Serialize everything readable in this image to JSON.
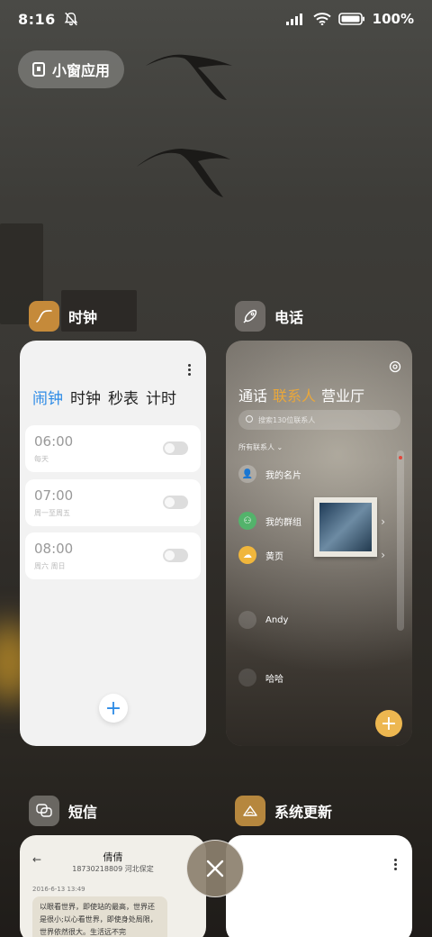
{
  "status_bar": {
    "time": "8:16",
    "battery": "100%"
  },
  "small_window": {
    "label": "小窗应用"
  },
  "apps": {
    "clock": {
      "name": "时钟",
      "icon_color": "#c58a3a",
      "tabs": [
        "闹钟",
        "计时",
        "秒表",
        "计时"
      ],
      "tab_labels": {
        "alarm": "闹钟",
        "clock": "时钟",
        "stopwatch": "秒表",
        "timer": "计时"
      },
      "active_tab": "闹钟",
      "accent": "#2d8be6",
      "alarms": [
        {
          "time": "06:00",
          "repeat": "每天"
        },
        {
          "time": "07:00",
          "repeat": "周一至周五"
        },
        {
          "time": "08:00",
          "repeat": "周六 周日"
        }
      ]
    },
    "phone": {
      "name": "电话",
      "tabs": {
        "calls": "通话",
        "contacts": "联系人",
        "hall": "营业厅"
      },
      "active_tab": "联系人",
      "accent": "#e9a73b",
      "search_placeholder": "搜索130位联系人",
      "section_label": "所有联系人",
      "contacts": [
        {
          "name": "我的名片"
        },
        {
          "name": "我的群组"
        },
        {
          "name": "黄页"
        },
        {
          "name": "Andy"
        },
        {
          "name": "哈哈"
        }
      ]
    },
    "sms": {
      "name": "短信",
      "contact": "倩倩",
      "number": "18730218809 河北保定",
      "date": "2016-6-13 13:49",
      "message": "以眼看世界，即使站的最高，世界还是很小;以心看世界，即使身处局限，世界依然很大。生活远不完"
    },
    "update": {
      "name": "系统更新"
    }
  }
}
